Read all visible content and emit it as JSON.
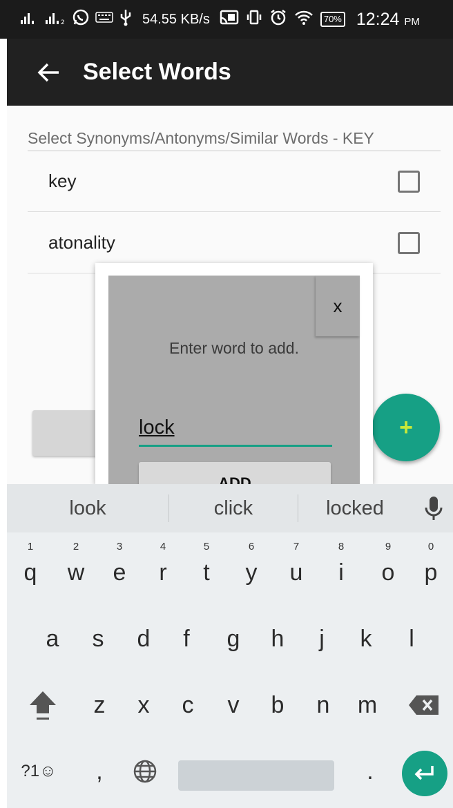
{
  "status_bar": {
    "net_speed": "54.55 KB/s",
    "battery": "70%",
    "time": "12:24",
    "ampm": "PM",
    "icons": [
      "signal-1-icon",
      "signal-2-icon",
      "whatsapp-icon",
      "keyboard-icon",
      "usb-icon",
      "cast-icon",
      "vibrate-icon",
      "alarm-icon",
      "wifi-icon",
      "battery-icon"
    ]
  },
  "app_bar": {
    "title": "Select Words",
    "back_icon": "arrow-left-icon"
  },
  "content": {
    "section_title": "Select Synonyms/Antonyms/Similar Words - KEY",
    "words": [
      {
        "label": "key",
        "checked": false
      },
      {
        "label": "atonality",
        "checked": false
      }
    ],
    "fab_icon": "plus-icon",
    "fab_label": "+"
  },
  "dialog": {
    "close_label": "x",
    "prompt": "Enter word to add.",
    "input_value": "lock",
    "add_label": "ADD"
  },
  "keyboard": {
    "suggestions": [
      "look",
      "click",
      "locked"
    ],
    "row1": [
      {
        "ch": "q",
        "hint": "1"
      },
      {
        "ch": "w",
        "hint": "2"
      },
      {
        "ch": "e",
        "hint": "3"
      },
      {
        "ch": "r",
        "hint": "4"
      },
      {
        "ch": "t",
        "hint": "5"
      },
      {
        "ch": "y",
        "hint": "6"
      },
      {
        "ch": "u",
        "hint": "7"
      },
      {
        "ch": "i",
        "hint": "8"
      },
      {
        "ch": "o",
        "hint": "9"
      },
      {
        "ch": "p",
        "hint": "0"
      }
    ],
    "row2": [
      "a",
      "s",
      "d",
      "f",
      "g",
      "h",
      "j",
      "k",
      "l"
    ],
    "row3": [
      "z",
      "x",
      "c",
      "v",
      "b",
      "n",
      "m"
    ],
    "symbols_label": "?1☺",
    "comma_label": ",",
    "period_label": ".",
    "colors": {
      "accent": "#16a085",
      "background": "#eceff1"
    }
  }
}
